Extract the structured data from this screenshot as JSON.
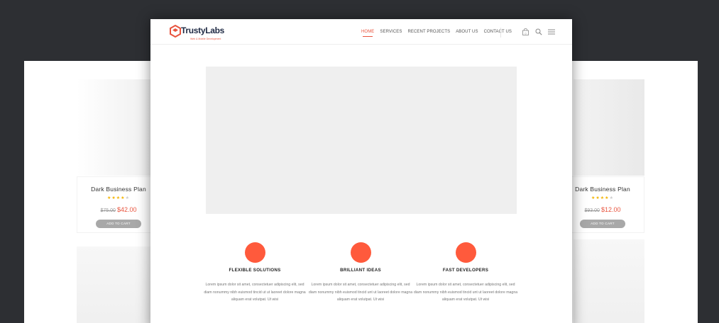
{
  "brand": {
    "name": "TrustyLabs",
    "tagline": "Web & Mobile Development",
    "accent_color": "#e8543e",
    "feature_color": "#ff5a3c"
  },
  "nav": {
    "items": [
      {
        "label": "HOME",
        "active": true
      },
      {
        "label": "SERVICES",
        "active": false
      },
      {
        "label": "RECENT PROJECTS",
        "active": false
      },
      {
        "label": "ABOUT US",
        "active": false
      },
      {
        "label": "CONTACT US",
        "active": false
      }
    ],
    "cart_count": "0",
    "icons": [
      "cart-icon",
      "search-icon",
      "menu-icon"
    ]
  },
  "products": [
    {
      "title": "Dark Business Plan",
      "rating": 4,
      "rating_max": 5,
      "old_price": "$75.00",
      "new_price": "$42.00",
      "button": "ADD TO CART"
    },
    {
      "title": "Dark Business Plan",
      "rating": 4,
      "rating_max": 5,
      "old_price": "$93.00",
      "new_price": "$12.00",
      "button": "ADD TO CART"
    }
  ],
  "features": [
    {
      "title": "FLEXIBLE SOLUTIONS",
      "text": "Lorem ipsum dolor sit amet, consectetuer adipiscing elit, sed diam nonummy nibh euismod tincid ut ut laoreet dolore magna aliquam erat volutpat. Ut wisi"
    },
    {
      "title": "BRILLIANT IDEAS",
      "text": "Lorem ipsum dolor sit amet, consectetuer adipiscing elit, sed diam nonummy nibh euismod tincid unt ut laoreet dolore magna aliquam erat volutpat. Ut wisi"
    },
    {
      "title": "FAST DEVELOPERS",
      "text": "Lorem ipsum dolor sit amet, consectetuer adipiscing elit, sed diam nonummy nibh euismod tincid unt ut laoreet dolore magna aliquam erat volutpat. Ut wisi"
    }
  ]
}
